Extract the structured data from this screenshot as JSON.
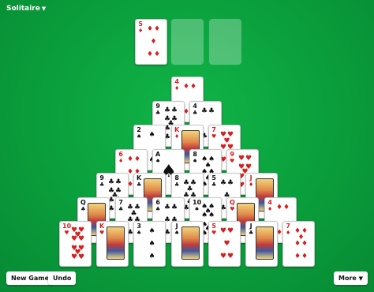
{
  "header": {
    "title": "Solitaire"
  },
  "buttons": {
    "new_game": "New Game",
    "undo": "Undo",
    "more": "More"
  },
  "stock_card": {
    "rank": "5",
    "suit": "♦",
    "color": "red",
    "pips": 5
  },
  "pyramid": [
    [
      {
        "rank": "4",
        "suit": "♦",
        "color": "red",
        "pips": 4
      }
    ],
    [
      {
        "rank": "9",
        "suit": "♣",
        "color": "black",
        "pips": 9
      },
      {
        "rank": "4",
        "suit": "♣",
        "color": "black",
        "pips": 4
      }
    ],
    [
      {
        "rank": "2",
        "suit": "♠",
        "color": "black",
        "pips": 2
      },
      {
        "rank": "K",
        "suit": "♦",
        "color": "red",
        "face": true
      },
      {
        "rank": "7",
        "suit": "♥",
        "color": "red",
        "pips": 7
      }
    ],
    [
      {
        "rank": "6",
        "suit": "♦",
        "color": "red",
        "pips": 6
      },
      {
        "rank": "A",
        "suit": "♠",
        "color": "black",
        "ace": true
      },
      {
        "rank": "8",
        "suit": "♠",
        "color": "black",
        "pips": 8
      },
      {
        "rank": "9",
        "suit": "♥",
        "color": "red",
        "pips": 9
      }
    ],
    [
      {
        "rank": "9",
        "suit": "♣",
        "color": "black",
        "pips": 9
      },
      {
        "rank": "K",
        "suit": "♣",
        "color": "black",
        "face": true
      },
      {
        "rank": "8",
        "suit": "♣",
        "color": "black",
        "pips": 8
      },
      {
        "rank": "5",
        "suit": "♣",
        "color": "black",
        "pips": 5
      },
      {
        "rank": "J",
        "suit": "♦",
        "color": "red",
        "face": true
      }
    ],
    [
      {
        "rank": "Q",
        "suit": "♣",
        "color": "black",
        "face": true
      },
      {
        "rank": "7",
        "suit": "♣",
        "color": "black",
        "pips": 7
      },
      {
        "rank": "6",
        "suit": "♣",
        "color": "black",
        "pips": 6
      },
      {
        "rank": "10",
        "suit": "♠",
        "color": "black",
        "pips": 10
      },
      {
        "rank": "Q",
        "suit": "♥",
        "color": "red",
        "face": true
      },
      {
        "rank": "4",
        "suit": "♦",
        "color": "red",
        "pips": 4
      }
    ],
    [
      {
        "rank": "10",
        "suit": "♥",
        "color": "red",
        "pips": 10
      },
      {
        "rank": "K",
        "suit": "♥",
        "color": "red",
        "face": true
      },
      {
        "rank": "3",
        "suit": "♠",
        "color": "black",
        "pips": 3
      },
      {
        "rank": "J",
        "suit": "♠",
        "color": "black",
        "face": true
      },
      {
        "rank": "5",
        "suit": "♥",
        "color": "red",
        "pips": 5
      },
      {
        "rank": "J",
        "suit": "♣",
        "color": "black",
        "face": true
      },
      {
        "rank": "7",
        "suit": "♦",
        "color": "red",
        "pips": 7
      }
    ]
  ],
  "colors": {
    "felt": "#0a9e3c",
    "red_suit": "#d41f1f",
    "black_suit": "#111111"
  }
}
